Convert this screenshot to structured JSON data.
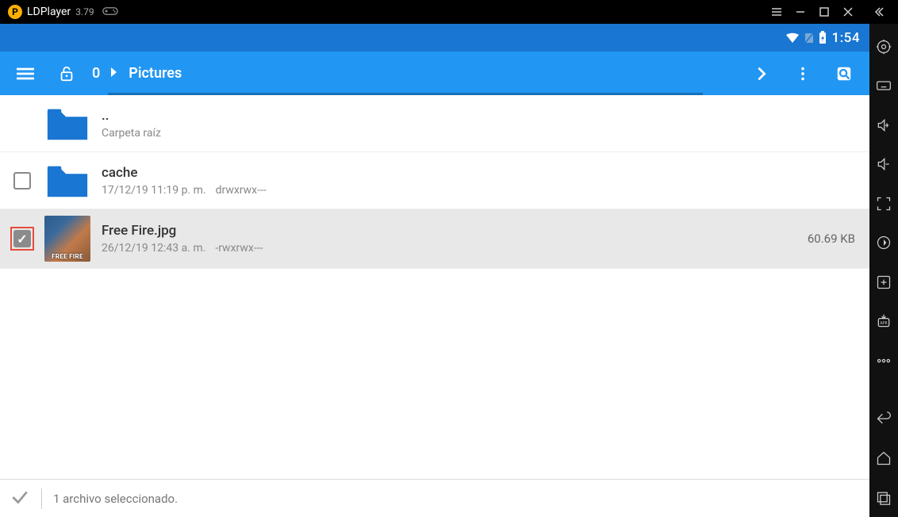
{
  "titlebar": {
    "app_logo_letter": "P",
    "app_name": "LDPlayer",
    "app_version": "3.79"
  },
  "status": {
    "time": "1:54"
  },
  "toolbar": {
    "count": "0",
    "path_name": "Pictures"
  },
  "files": [
    {
      "name": "..",
      "subtitle": "Carpeta raíz",
      "type": "folder",
      "checkbox": false,
      "checked": false,
      "size": ""
    },
    {
      "name": "cache",
      "date": "17/12/19 11:19 p. m.",
      "perm": "drwxrwx---",
      "type": "folder",
      "checkbox": true,
      "checked": false,
      "size": ""
    },
    {
      "name": "Free Fire.jpg",
      "date": "26/12/19 12:43 a. m.",
      "perm": "-rwxrwx---",
      "type": "image",
      "checkbox": true,
      "checked": true,
      "highlighted": true,
      "size": "60.69 KB",
      "thumb_text": "FREE FIRE"
    }
  ],
  "bottom": {
    "status_text": "1 archivo seleccionado."
  }
}
